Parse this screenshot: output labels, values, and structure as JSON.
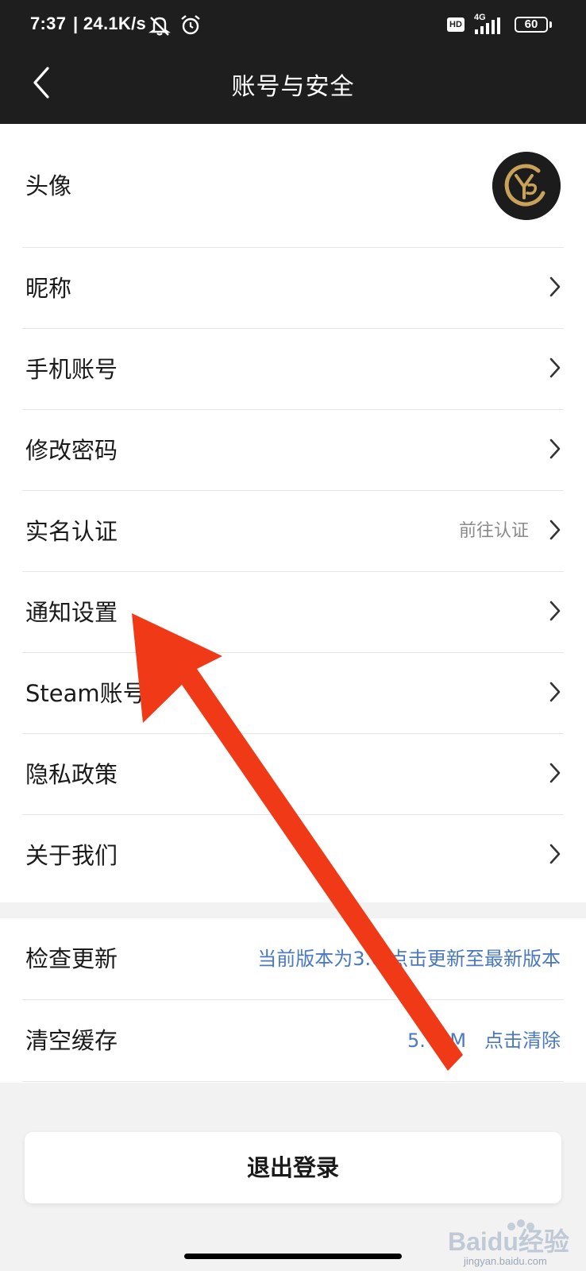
{
  "status_bar": {
    "time": "7:37",
    "network_speed": "| 24.1K/s",
    "hd_badge": "HD",
    "network_type": "4G",
    "battery": "60"
  },
  "nav": {
    "title": "账号与安全"
  },
  "settings": {
    "avatar_label": "头像",
    "items": [
      {
        "label": "昵称",
        "value": ""
      },
      {
        "label": "手机账号",
        "value": ""
      },
      {
        "label": "修改密码",
        "value": ""
      },
      {
        "label": "实名认证",
        "value": "前往认证"
      },
      {
        "label": "通知设置",
        "value": ""
      },
      {
        "label": "Steam账号",
        "value": ""
      },
      {
        "label": "隐私政策",
        "value": ""
      },
      {
        "label": "关于我们",
        "value": ""
      }
    ]
  },
  "app_info": {
    "check_update_label": "检查更新",
    "check_update_value": "当前版本为3.6 点击更新至最新版本",
    "clear_cache_label": "清空缓存",
    "clear_cache_value": "5.  2M   点击清除"
  },
  "logout_label": "退出登录",
  "watermark": {
    "brand": "Baidu经验",
    "site": "jingyan.baidu.com"
  },
  "colors": {
    "header_bg": "#1e1e1e",
    "link_blue": "#4a78c2",
    "annotation_arrow": "#f03a17",
    "avatar_gold": "#c9a25a"
  }
}
